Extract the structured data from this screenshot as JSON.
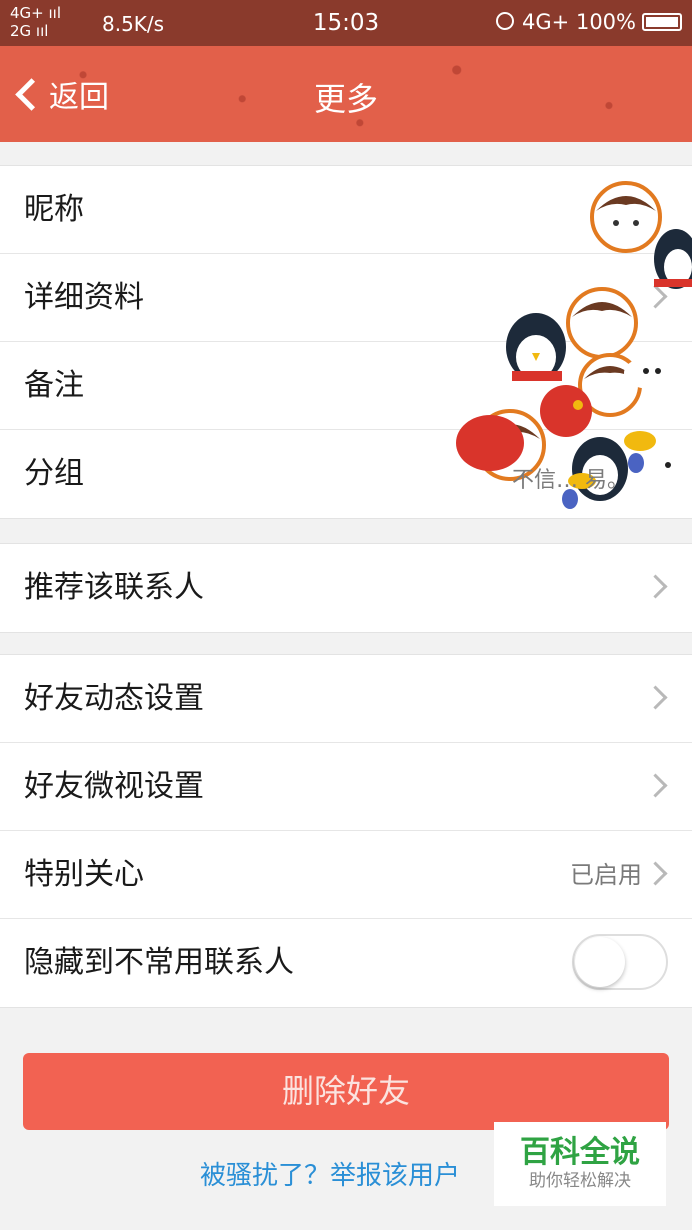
{
  "status_bar": {
    "network_top": "4G+ ııl",
    "network_bottom": "2G ııl",
    "speed": "8.5K/s",
    "time": "15:03",
    "network_right": "4G+",
    "battery": "100%"
  },
  "nav": {
    "back_label": "返回",
    "title": "更多"
  },
  "group1": {
    "nickname_label": "昵称",
    "details_label": "详细资料",
    "remark_label": "备注",
    "group_label": "分组",
    "group_value_partial": "不信… 易。"
  },
  "group2": {
    "recommend_label": "推荐该联系人"
  },
  "group3": {
    "feed_label": "好友动态设置",
    "weishi_label": "好友微视设置",
    "special_label": "特别关心",
    "special_value": "已启用",
    "hide_label": "隐藏到不常用联系人"
  },
  "hide_toggle_on": false,
  "actions": {
    "delete_label": "删除好友",
    "report_label": "被骚扰了？举报该用户"
  },
  "watermark": {
    "title": "百科全说",
    "subtitle": "助你轻松解决"
  },
  "colors": {
    "nav_bg": "#e2604a",
    "status_bg": "#8a3a2c",
    "delete_bg": "#f26252",
    "link": "#2a8fd6"
  }
}
